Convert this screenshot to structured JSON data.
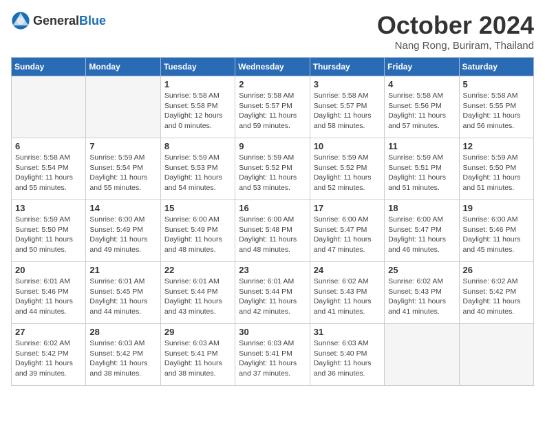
{
  "header": {
    "logo_general": "General",
    "logo_blue": "Blue",
    "month": "October 2024",
    "location": "Nang Rong, Buriram, Thailand"
  },
  "weekdays": [
    "Sunday",
    "Monday",
    "Tuesday",
    "Wednesday",
    "Thursday",
    "Friday",
    "Saturday"
  ],
  "weeks": [
    [
      {
        "day": "",
        "info": ""
      },
      {
        "day": "",
        "info": ""
      },
      {
        "day": "1",
        "info": "Sunrise: 5:58 AM\nSunset: 5:58 PM\nDaylight: 12 hours and 0 minutes."
      },
      {
        "day": "2",
        "info": "Sunrise: 5:58 AM\nSunset: 5:57 PM\nDaylight: 11 hours and 59 minutes."
      },
      {
        "day": "3",
        "info": "Sunrise: 5:58 AM\nSunset: 5:57 PM\nDaylight: 11 hours and 58 minutes."
      },
      {
        "day": "4",
        "info": "Sunrise: 5:58 AM\nSunset: 5:56 PM\nDaylight: 11 hours and 57 minutes."
      },
      {
        "day": "5",
        "info": "Sunrise: 5:58 AM\nSunset: 5:55 PM\nDaylight: 11 hours and 56 minutes."
      }
    ],
    [
      {
        "day": "6",
        "info": "Sunrise: 5:58 AM\nSunset: 5:54 PM\nDaylight: 11 hours and 55 minutes."
      },
      {
        "day": "7",
        "info": "Sunrise: 5:59 AM\nSunset: 5:54 PM\nDaylight: 11 hours and 55 minutes."
      },
      {
        "day": "8",
        "info": "Sunrise: 5:59 AM\nSunset: 5:53 PM\nDaylight: 11 hours and 54 minutes."
      },
      {
        "day": "9",
        "info": "Sunrise: 5:59 AM\nSunset: 5:52 PM\nDaylight: 11 hours and 53 minutes."
      },
      {
        "day": "10",
        "info": "Sunrise: 5:59 AM\nSunset: 5:52 PM\nDaylight: 11 hours and 52 minutes."
      },
      {
        "day": "11",
        "info": "Sunrise: 5:59 AM\nSunset: 5:51 PM\nDaylight: 11 hours and 51 minutes."
      },
      {
        "day": "12",
        "info": "Sunrise: 5:59 AM\nSunset: 5:50 PM\nDaylight: 11 hours and 51 minutes."
      }
    ],
    [
      {
        "day": "13",
        "info": "Sunrise: 5:59 AM\nSunset: 5:50 PM\nDaylight: 11 hours and 50 minutes."
      },
      {
        "day": "14",
        "info": "Sunrise: 6:00 AM\nSunset: 5:49 PM\nDaylight: 11 hours and 49 minutes."
      },
      {
        "day": "15",
        "info": "Sunrise: 6:00 AM\nSunset: 5:49 PM\nDaylight: 11 hours and 48 minutes."
      },
      {
        "day": "16",
        "info": "Sunrise: 6:00 AM\nSunset: 5:48 PM\nDaylight: 11 hours and 48 minutes."
      },
      {
        "day": "17",
        "info": "Sunrise: 6:00 AM\nSunset: 5:47 PM\nDaylight: 11 hours and 47 minutes."
      },
      {
        "day": "18",
        "info": "Sunrise: 6:00 AM\nSunset: 5:47 PM\nDaylight: 11 hours and 46 minutes."
      },
      {
        "day": "19",
        "info": "Sunrise: 6:00 AM\nSunset: 5:46 PM\nDaylight: 11 hours and 45 minutes."
      }
    ],
    [
      {
        "day": "20",
        "info": "Sunrise: 6:01 AM\nSunset: 5:46 PM\nDaylight: 11 hours and 44 minutes."
      },
      {
        "day": "21",
        "info": "Sunrise: 6:01 AM\nSunset: 5:45 PM\nDaylight: 11 hours and 44 minutes."
      },
      {
        "day": "22",
        "info": "Sunrise: 6:01 AM\nSunset: 5:44 PM\nDaylight: 11 hours and 43 minutes."
      },
      {
        "day": "23",
        "info": "Sunrise: 6:01 AM\nSunset: 5:44 PM\nDaylight: 11 hours and 42 minutes."
      },
      {
        "day": "24",
        "info": "Sunrise: 6:02 AM\nSunset: 5:43 PM\nDaylight: 11 hours and 41 minutes."
      },
      {
        "day": "25",
        "info": "Sunrise: 6:02 AM\nSunset: 5:43 PM\nDaylight: 11 hours and 41 minutes."
      },
      {
        "day": "26",
        "info": "Sunrise: 6:02 AM\nSunset: 5:42 PM\nDaylight: 11 hours and 40 minutes."
      }
    ],
    [
      {
        "day": "27",
        "info": "Sunrise: 6:02 AM\nSunset: 5:42 PM\nDaylight: 11 hours and 39 minutes."
      },
      {
        "day": "28",
        "info": "Sunrise: 6:03 AM\nSunset: 5:42 PM\nDaylight: 11 hours and 38 minutes."
      },
      {
        "day": "29",
        "info": "Sunrise: 6:03 AM\nSunset: 5:41 PM\nDaylight: 11 hours and 38 minutes."
      },
      {
        "day": "30",
        "info": "Sunrise: 6:03 AM\nSunset: 5:41 PM\nDaylight: 11 hours and 37 minutes."
      },
      {
        "day": "31",
        "info": "Sunrise: 6:03 AM\nSunset: 5:40 PM\nDaylight: 11 hours and 36 minutes."
      },
      {
        "day": "",
        "info": ""
      },
      {
        "day": "",
        "info": ""
      }
    ]
  ]
}
